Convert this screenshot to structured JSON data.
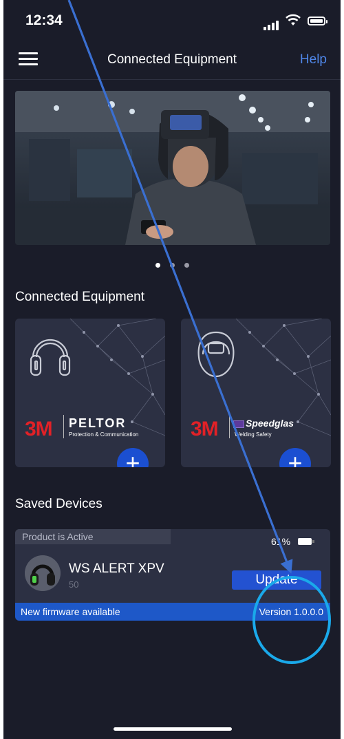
{
  "status_bar": {
    "time": "12:34"
  },
  "header": {
    "title": "Connected Equipment",
    "help_label": "Help"
  },
  "carousel": {
    "page_count": 3,
    "active_index": 0
  },
  "connected_section": {
    "title": "Connected Equipment"
  },
  "cards": [
    {
      "brand_mark": "3M",
      "brand_name": "PELTOR",
      "brand_sub": "Protection & Communication",
      "icon": "headset-icon",
      "add_symbol": "+"
    },
    {
      "brand_mark": "3M",
      "brand_name": "Speedglas",
      "brand_sub": "Welding Safety",
      "icon": "welding-helmet-icon",
      "add_symbol": "+"
    }
  ],
  "saved_section": {
    "title": "Saved Devices"
  },
  "saved_device": {
    "status": "Product is Active",
    "battery": "61%",
    "name": "WS ALERT XPV",
    "number": "50",
    "update_label": "Update",
    "firmware_message": "New firmware available",
    "version": "Version 1.0.0.0"
  },
  "colors": {
    "background": "#1a1c29",
    "card": "#2c3043",
    "accent": "#2352d1",
    "link": "#4f86e8",
    "brand_red": "#e12127",
    "annotation": "#1aa9ea"
  }
}
